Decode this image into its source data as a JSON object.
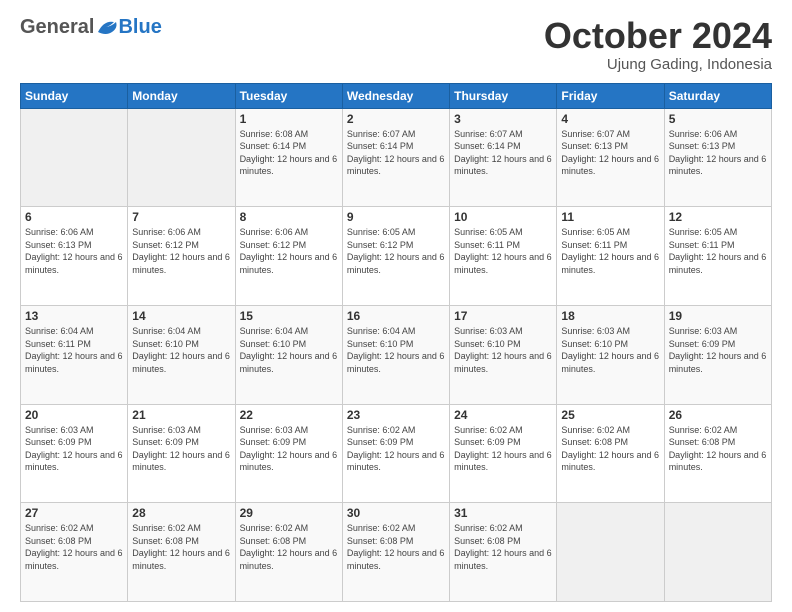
{
  "logo": {
    "general": "General",
    "blue": "Blue"
  },
  "header": {
    "month": "October 2024",
    "location": "Ujung Gading, Indonesia"
  },
  "weekdays": [
    "Sunday",
    "Monday",
    "Tuesday",
    "Wednesday",
    "Thursday",
    "Friday",
    "Saturday"
  ],
  "weeks": [
    [
      {
        "day": "",
        "sunrise": "",
        "sunset": "",
        "daylight": ""
      },
      {
        "day": "",
        "sunrise": "",
        "sunset": "",
        "daylight": ""
      },
      {
        "day": "1",
        "sunrise": "Sunrise: 6:08 AM",
        "sunset": "Sunset: 6:14 PM",
        "daylight": "Daylight: 12 hours and 6 minutes."
      },
      {
        "day": "2",
        "sunrise": "Sunrise: 6:07 AM",
        "sunset": "Sunset: 6:14 PM",
        "daylight": "Daylight: 12 hours and 6 minutes."
      },
      {
        "day": "3",
        "sunrise": "Sunrise: 6:07 AM",
        "sunset": "Sunset: 6:14 PM",
        "daylight": "Daylight: 12 hours and 6 minutes."
      },
      {
        "day": "4",
        "sunrise": "Sunrise: 6:07 AM",
        "sunset": "Sunset: 6:13 PM",
        "daylight": "Daylight: 12 hours and 6 minutes."
      },
      {
        "day": "5",
        "sunrise": "Sunrise: 6:06 AM",
        "sunset": "Sunset: 6:13 PM",
        "daylight": "Daylight: 12 hours and 6 minutes."
      }
    ],
    [
      {
        "day": "6",
        "sunrise": "Sunrise: 6:06 AM",
        "sunset": "Sunset: 6:13 PM",
        "daylight": "Daylight: 12 hours and 6 minutes."
      },
      {
        "day": "7",
        "sunrise": "Sunrise: 6:06 AM",
        "sunset": "Sunset: 6:12 PM",
        "daylight": "Daylight: 12 hours and 6 minutes."
      },
      {
        "day": "8",
        "sunrise": "Sunrise: 6:06 AM",
        "sunset": "Sunset: 6:12 PM",
        "daylight": "Daylight: 12 hours and 6 minutes."
      },
      {
        "day": "9",
        "sunrise": "Sunrise: 6:05 AM",
        "sunset": "Sunset: 6:12 PM",
        "daylight": "Daylight: 12 hours and 6 minutes."
      },
      {
        "day": "10",
        "sunrise": "Sunrise: 6:05 AM",
        "sunset": "Sunset: 6:11 PM",
        "daylight": "Daylight: 12 hours and 6 minutes."
      },
      {
        "day": "11",
        "sunrise": "Sunrise: 6:05 AM",
        "sunset": "Sunset: 6:11 PM",
        "daylight": "Daylight: 12 hours and 6 minutes."
      },
      {
        "day": "12",
        "sunrise": "Sunrise: 6:05 AM",
        "sunset": "Sunset: 6:11 PM",
        "daylight": "Daylight: 12 hours and 6 minutes."
      }
    ],
    [
      {
        "day": "13",
        "sunrise": "Sunrise: 6:04 AM",
        "sunset": "Sunset: 6:11 PM",
        "daylight": "Daylight: 12 hours and 6 minutes."
      },
      {
        "day": "14",
        "sunrise": "Sunrise: 6:04 AM",
        "sunset": "Sunset: 6:10 PM",
        "daylight": "Daylight: 12 hours and 6 minutes."
      },
      {
        "day": "15",
        "sunrise": "Sunrise: 6:04 AM",
        "sunset": "Sunset: 6:10 PM",
        "daylight": "Daylight: 12 hours and 6 minutes."
      },
      {
        "day": "16",
        "sunrise": "Sunrise: 6:04 AM",
        "sunset": "Sunset: 6:10 PM",
        "daylight": "Daylight: 12 hours and 6 minutes."
      },
      {
        "day": "17",
        "sunrise": "Sunrise: 6:03 AM",
        "sunset": "Sunset: 6:10 PM",
        "daylight": "Daylight: 12 hours and 6 minutes."
      },
      {
        "day": "18",
        "sunrise": "Sunrise: 6:03 AM",
        "sunset": "Sunset: 6:10 PM",
        "daylight": "Daylight: 12 hours and 6 minutes."
      },
      {
        "day": "19",
        "sunrise": "Sunrise: 6:03 AM",
        "sunset": "Sunset: 6:09 PM",
        "daylight": "Daylight: 12 hours and 6 minutes."
      }
    ],
    [
      {
        "day": "20",
        "sunrise": "Sunrise: 6:03 AM",
        "sunset": "Sunset: 6:09 PM",
        "daylight": "Daylight: 12 hours and 6 minutes."
      },
      {
        "day": "21",
        "sunrise": "Sunrise: 6:03 AM",
        "sunset": "Sunset: 6:09 PM",
        "daylight": "Daylight: 12 hours and 6 minutes."
      },
      {
        "day": "22",
        "sunrise": "Sunrise: 6:03 AM",
        "sunset": "Sunset: 6:09 PM",
        "daylight": "Daylight: 12 hours and 6 minutes."
      },
      {
        "day": "23",
        "sunrise": "Sunrise: 6:02 AM",
        "sunset": "Sunset: 6:09 PM",
        "daylight": "Daylight: 12 hours and 6 minutes."
      },
      {
        "day": "24",
        "sunrise": "Sunrise: 6:02 AM",
        "sunset": "Sunset: 6:09 PM",
        "daylight": "Daylight: 12 hours and 6 minutes."
      },
      {
        "day": "25",
        "sunrise": "Sunrise: 6:02 AM",
        "sunset": "Sunset: 6:08 PM",
        "daylight": "Daylight: 12 hours and 6 minutes."
      },
      {
        "day": "26",
        "sunrise": "Sunrise: 6:02 AM",
        "sunset": "Sunset: 6:08 PM",
        "daylight": "Daylight: 12 hours and 6 minutes."
      }
    ],
    [
      {
        "day": "27",
        "sunrise": "Sunrise: 6:02 AM",
        "sunset": "Sunset: 6:08 PM",
        "daylight": "Daylight: 12 hours and 6 minutes."
      },
      {
        "day": "28",
        "sunrise": "Sunrise: 6:02 AM",
        "sunset": "Sunset: 6:08 PM",
        "daylight": "Daylight: 12 hours and 6 minutes."
      },
      {
        "day": "29",
        "sunrise": "Sunrise: 6:02 AM",
        "sunset": "Sunset: 6:08 PM",
        "daylight": "Daylight: 12 hours and 6 minutes."
      },
      {
        "day": "30",
        "sunrise": "Sunrise: 6:02 AM",
        "sunset": "Sunset: 6:08 PM",
        "daylight": "Daylight: 12 hours and 6 minutes."
      },
      {
        "day": "31",
        "sunrise": "Sunrise: 6:02 AM",
        "sunset": "Sunset: 6:08 PM",
        "daylight": "Daylight: 12 hours and 6 minutes."
      },
      {
        "day": "",
        "sunrise": "",
        "sunset": "",
        "daylight": ""
      },
      {
        "day": "",
        "sunrise": "",
        "sunset": "",
        "daylight": ""
      }
    ]
  ]
}
